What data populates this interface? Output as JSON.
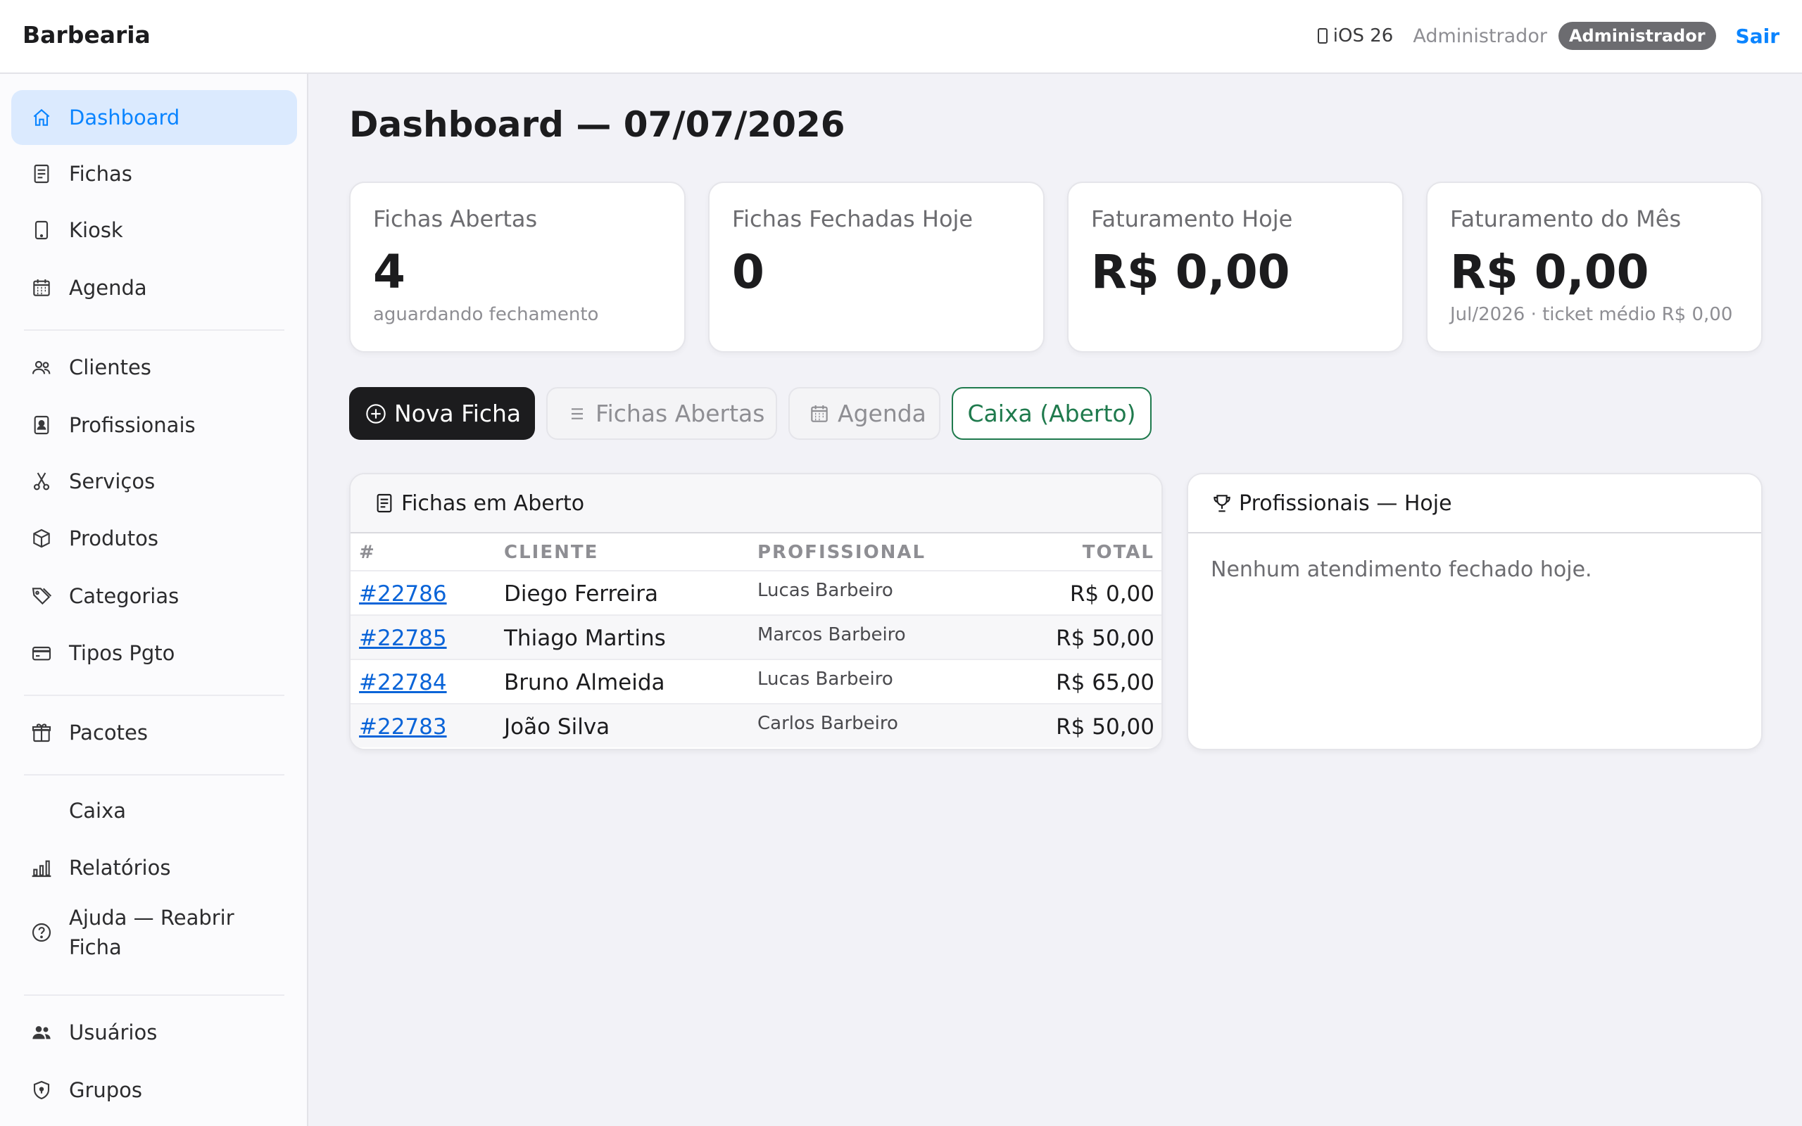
{
  "header": {
    "brand": "Barbearia",
    "platform": "iOS 26",
    "username": "Administrador",
    "role_badge": "Administrador",
    "logout": "Sair"
  },
  "sidebar": {
    "items": [
      {
        "label": "Dashboard",
        "icon": "home-icon"
      },
      {
        "label": "Fichas",
        "icon": "document-icon"
      },
      {
        "label": "Kiosk",
        "icon": "tablet-icon"
      },
      {
        "label": "Agenda",
        "icon": "calendar-icon"
      },
      {
        "label": "Clientes",
        "icon": "people-icon"
      },
      {
        "label": "Profissionais",
        "icon": "id-badge-icon"
      },
      {
        "label": "Serviços",
        "icon": "scissors-icon"
      },
      {
        "label": "Produtos",
        "icon": "box-icon"
      },
      {
        "label": "Categorias",
        "icon": "tags-icon"
      },
      {
        "label": "Tipos Pgto",
        "icon": "credit-card-icon"
      },
      {
        "label": "Pacotes",
        "icon": "gift-icon"
      },
      {
        "label": "Caixa",
        "icon": ""
      },
      {
        "label": "Relatórios",
        "icon": "bar-chart-icon"
      },
      {
        "label": "Ajuda — Reabrir Ficha",
        "icon": "question-circle-icon"
      },
      {
        "label": "Usuários",
        "icon": "users-fill-icon"
      },
      {
        "label": "Grupos",
        "icon": "shield-lock-icon"
      }
    ],
    "active": "Dashboard"
  },
  "main": {
    "title": "Dashboard — 07/07/2026",
    "stats": [
      {
        "label": "Fichas Abertas",
        "value": "4",
        "sub": "aguardando fechamento"
      },
      {
        "label": "Fichas Fechadas Hoje",
        "value": "0",
        "sub": ""
      },
      {
        "label": "Faturamento Hoje",
        "value": "R$ 0,00",
        "sub": ""
      },
      {
        "label": "Faturamento do Mês",
        "value": "R$ 0,00",
        "sub": "Jul/2026 · ticket médio R$ 0,00"
      }
    ],
    "actions": {
      "new_ficha": "Nova Ficha",
      "open_fichas": "Fichas Abertas",
      "agenda": "Agenda",
      "caixa": "Caixa (Aberto)"
    },
    "open_panel": {
      "title": "Fichas em Aberto",
      "columns": [
        "#",
        "CLIENTE",
        "PROFISSIONAL",
        "TOTAL"
      ],
      "rows": [
        {
          "id": "#22786",
          "cliente": "Diego Ferreira",
          "profissional": "Lucas Barbeiro",
          "total": "R$ 0,00"
        },
        {
          "id": "#22785",
          "cliente": "Thiago Martins",
          "profissional": "Marcos Barbeiro",
          "total": "R$ 50,00"
        },
        {
          "id": "#22784",
          "cliente": "Bruno Almeida",
          "profissional": "Lucas Barbeiro",
          "total": "R$ 65,00"
        },
        {
          "id": "#22783",
          "cliente": "João Silva",
          "profissional": "Carlos Barbeiro",
          "total": "R$ 50,00"
        }
      ]
    },
    "pros_panel": {
      "title": "Profissionais — Hoje",
      "empty": "Nenhum atendimento fechado hoje."
    }
  },
  "colors": {
    "accent": "#0a84ff",
    "active_bg": "#dbeafe",
    "success": "#1f7a4d",
    "dark_button": "#1c1c1e",
    "badge": "#6c6c70"
  }
}
